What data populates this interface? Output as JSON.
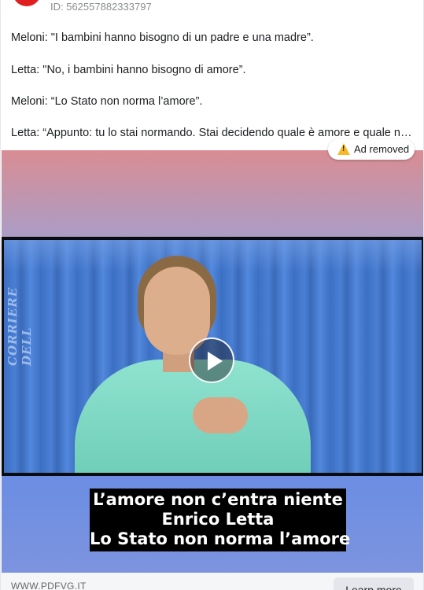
{
  "ad": {
    "id_text": "ID: 562557882333797"
  },
  "post": {
    "lines": [
      "Meloni: \"I bambini hanno bisogno di un padre e una madre”.",
      "Letta: \"No, i bambini hanno bisogno di amore”.",
      "Meloni: “Lo Stato non norma l’amore”.",
      "Letta: “Appunto: tu lo stai normando. Stai decidendo quale è amore e quale non è..."
    ]
  },
  "badge": {
    "label": "Ad removed",
    "icon": "warning-icon",
    "glyph": "!",
    "color": "#f7b928"
  },
  "video": {
    "watermark": "CORRIERE DELL",
    "caption_lines": [
      "L’amore non c’entra niente",
      "Enrico Letta",
      "Lo Stato non norma l’amore"
    ],
    "play_icon": "play-icon"
  },
  "footer": {
    "domain": "WWW.PDFVG.IT",
    "cta_label": "Learn more"
  }
}
